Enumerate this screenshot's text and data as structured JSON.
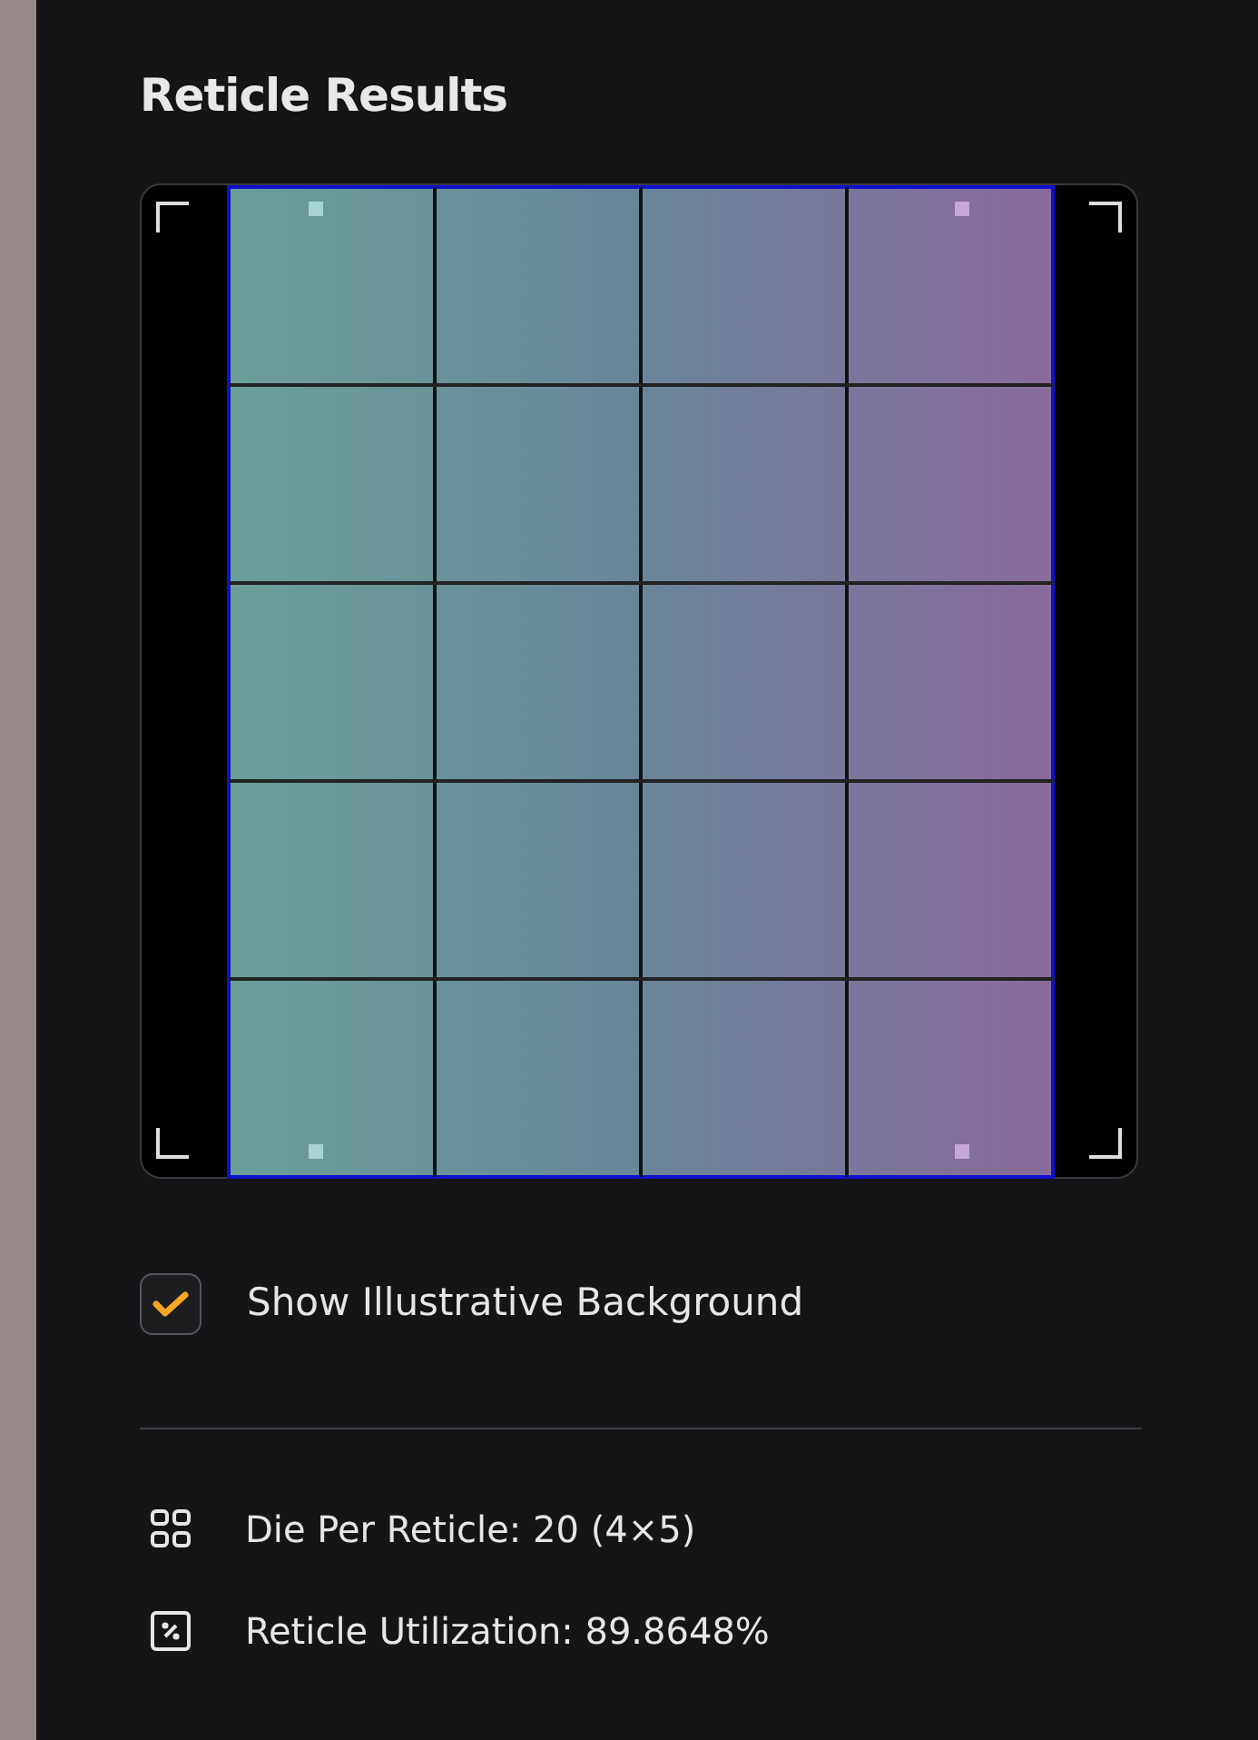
{
  "title": "Reticle Results",
  "background_option": {
    "label": "Show Illustrative Background",
    "checked": true
  },
  "stats": [
    {
      "kind": "grid",
      "text": "Die Per Reticle: 20 (4×5)"
    },
    {
      "kind": "percent",
      "text": "Reticle Utilization: 89.8648%"
    }
  ]
}
